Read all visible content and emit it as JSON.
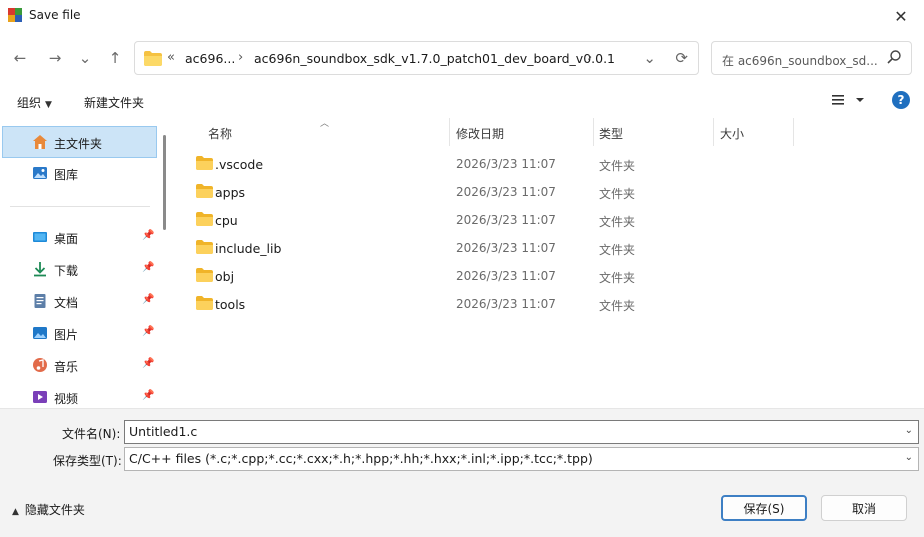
{
  "window": {
    "title": "Save file",
    "close_glyph": "✕"
  },
  "nav": {
    "back_glyph": "←",
    "forward_glyph": "→",
    "recent_glyph": "⌄",
    "up_glyph": "↑",
    "breadcrumb_overflow": "«",
    "breadcrumbs": [
      "ac696...",
      "ac696n_soundbox_sdk_v1.7.0_patch01_dev_board_v0.0.1"
    ],
    "sep_glyph": "›",
    "dropdown_glyph": "⌄",
    "refresh_glyph": "⟳",
    "search_placeholder": "在 ac696n_soundbox_sd..."
  },
  "toolbar": {
    "organize": "组织",
    "new_folder": "新建文件夹",
    "caret": "▼",
    "help": "?"
  },
  "sidebar": {
    "items": [
      {
        "label": "主文件夹",
        "icon": "home-icon",
        "selected": true
      },
      {
        "label": "图库",
        "icon": "gallery-icon"
      },
      {
        "label": "桌面",
        "icon": "desktop-icon",
        "pinned": true
      },
      {
        "label": "下载",
        "icon": "download-icon",
        "pinned": true
      },
      {
        "label": "文档",
        "icon": "document-icon",
        "pinned": true
      },
      {
        "label": "图片",
        "icon": "picture-icon",
        "pinned": true
      },
      {
        "label": "音乐",
        "icon": "music-icon",
        "pinned": true
      },
      {
        "label": "视频",
        "icon": "video-icon",
        "pinned": true
      }
    ],
    "pin_glyph": "📌"
  },
  "filelist": {
    "columns": {
      "name": "名称",
      "modified": "修改日期",
      "type": "类型",
      "size": "大小"
    },
    "sort_glyph": "︿",
    "rows": [
      {
        "name": ".vscode",
        "modified": "2026/3/23 11:07",
        "type": "文件夹"
      },
      {
        "name": "apps",
        "modified": "2026/3/23 11:07",
        "type": "文件夹"
      },
      {
        "name": "cpu",
        "modified": "2026/3/23 11:07",
        "type": "文件夹"
      },
      {
        "name": "include_lib",
        "modified": "2026/3/23 11:07",
        "type": "文件夹"
      },
      {
        "name": "obj",
        "modified": "2026/3/23 11:07",
        "type": "文件夹"
      },
      {
        "name": "tools",
        "modified": "2026/3/23 11:07",
        "type": "文件夹"
      }
    ]
  },
  "form": {
    "filename_label": "文件名(N):",
    "filename_value": "Untitled1.c",
    "filetype_label": "保存类型(T):",
    "filetype_value": "C/C++ files (*.c;*.cpp;*.cc;*.cxx;*.h;*.hpp;*.hh;*.hxx;*.inl;*.ipp;*.tcc;*.tpp)",
    "dropdown_glyph": "⌄"
  },
  "footer": {
    "hide_folders": "隐藏文件夹",
    "hide_caret": "▲",
    "save": "保存(S)",
    "cancel": "取消"
  },
  "colors": {
    "accent": "#1f6fbf",
    "folder": "#f5c242",
    "selection": "#cce4f7"
  }
}
